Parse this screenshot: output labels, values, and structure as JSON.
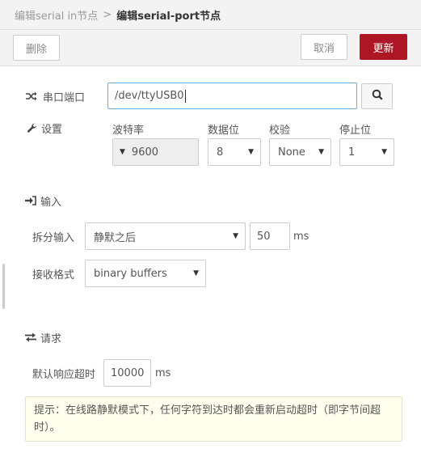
{
  "breadcrumb": {
    "parent": "编辑serial in节点",
    "separator": ">",
    "current": "编辑serial-port节点"
  },
  "toolbar": {
    "delete_label": "删除",
    "cancel_label": "取消",
    "update_label": "更新"
  },
  "port": {
    "label": "串口端口",
    "value": "/dev/ttyUSB0",
    "search_icon": "search-icon"
  },
  "settings": {
    "label": "设置",
    "baud_rate": {
      "label": "波特率",
      "value": "9600"
    },
    "data_bits": {
      "label": "数据位",
      "value": "8"
    },
    "parity": {
      "label": "校验",
      "value": "None"
    },
    "stop_bits": {
      "label": "停止位",
      "value": "1"
    }
  },
  "input": {
    "section_label": "输入",
    "split_label": "拆分输入",
    "split_value": "静默之后",
    "split_timeout": "50",
    "split_unit": "ms",
    "format_label": "接收格式",
    "format_value": "binary buffers"
  },
  "request": {
    "section_label": "请求",
    "timeout_label": "默认响应超时",
    "timeout_value": "10000",
    "timeout_unit": "ms"
  },
  "tip": "提示：在线路静默模式下，任何字符到达时都会重新启动超时（即字节间超时）。",
  "colors": {
    "accent": "#ad1625",
    "toolbar_bg": "#f3f3f3",
    "tip_bg": "#ffffee"
  }
}
